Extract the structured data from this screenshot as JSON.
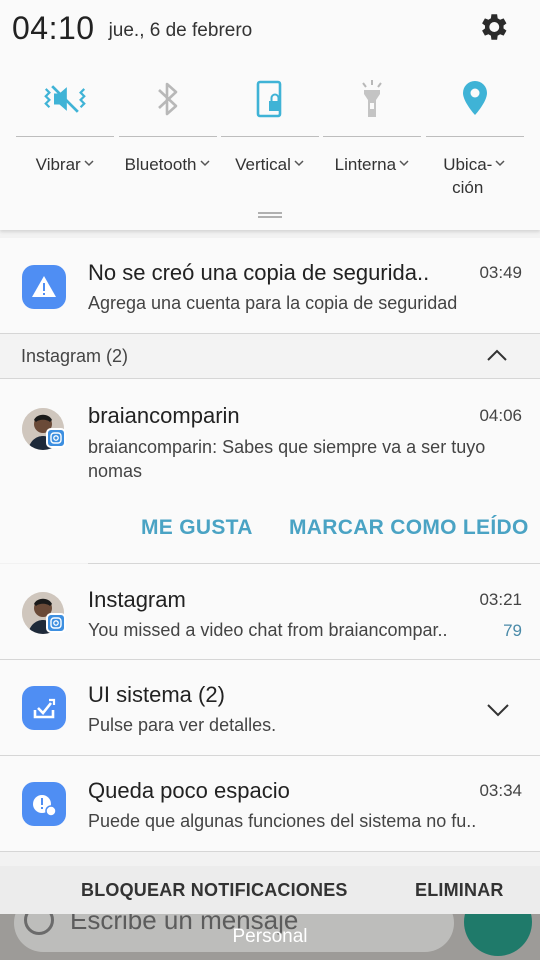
{
  "status": {
    "time": "04:10",
    "date": "jue., 6 de febrero"
  },
  "quick_settings": {
    "tiles": [
      {
        "label": "Vibrar",
        "icon": "vibrate-icon",
        "active": true
      },
      {
        "label": "Bluetooth",
        "icon": "bluetooth-icon",
        "active": false
      },
      {
        "label": "Vertical",
        "icon": "rotation-lock-icon",
        "active": true
      },
      {
        "label": "Linterna",
        "icon": "flashlight-icon",
        "active": false
      },
      {
        "label": "Ubica-\nción",
        "icon": "location-icon",
        "active": true
      }
    ]
  },
  "notifications": {
    "backup": {
      "title": "No se creó una copia de segurida..",
      "text": "Agrega una cuenta para la copia de seguridad",
      "time": "03:49"
    },
    "instagram_group": {
      "header": "Instagram (2)",
      "message": {
        "title": "braiancomparin",
        "text": "braiancomparin: Sabes que siempre va a ser tuyo nomas",
        "time": "04:06",
        "action_like": "ME GUSTA",
        "action_read": "MARCAR COMO LEÍDO"
      },
      "video": {
        "title": "Instagram",
        "text": "You missed a video chat from braiancompar..",
        "time": "03:21",
        "count": "79"
      }
    },
    "system": {
      "title": "UI sistema (2)",
      "text": "Pulse para ver detalles."
    },
    "storage": {
      "title": "Queda poco espacio",
      "text": "Puede que algunas funciones del sistema no fu..",
      "time": "03:34"
    }
  },
  "bottom_actions": {
    "block": "BLOQUEAR NOTIFICACIONES",
    "clear": "ELIMINAR"
  },
  "background": {
    "input_placeholder": "Escribe un mensaje",
    "profile_label": "Personal"
  },
  "colors": {
    "accent": "#3fb3d6",
    "icon_blue": "#4f8ef3",
    "action_text": "#4aa3c4"
  }
}
